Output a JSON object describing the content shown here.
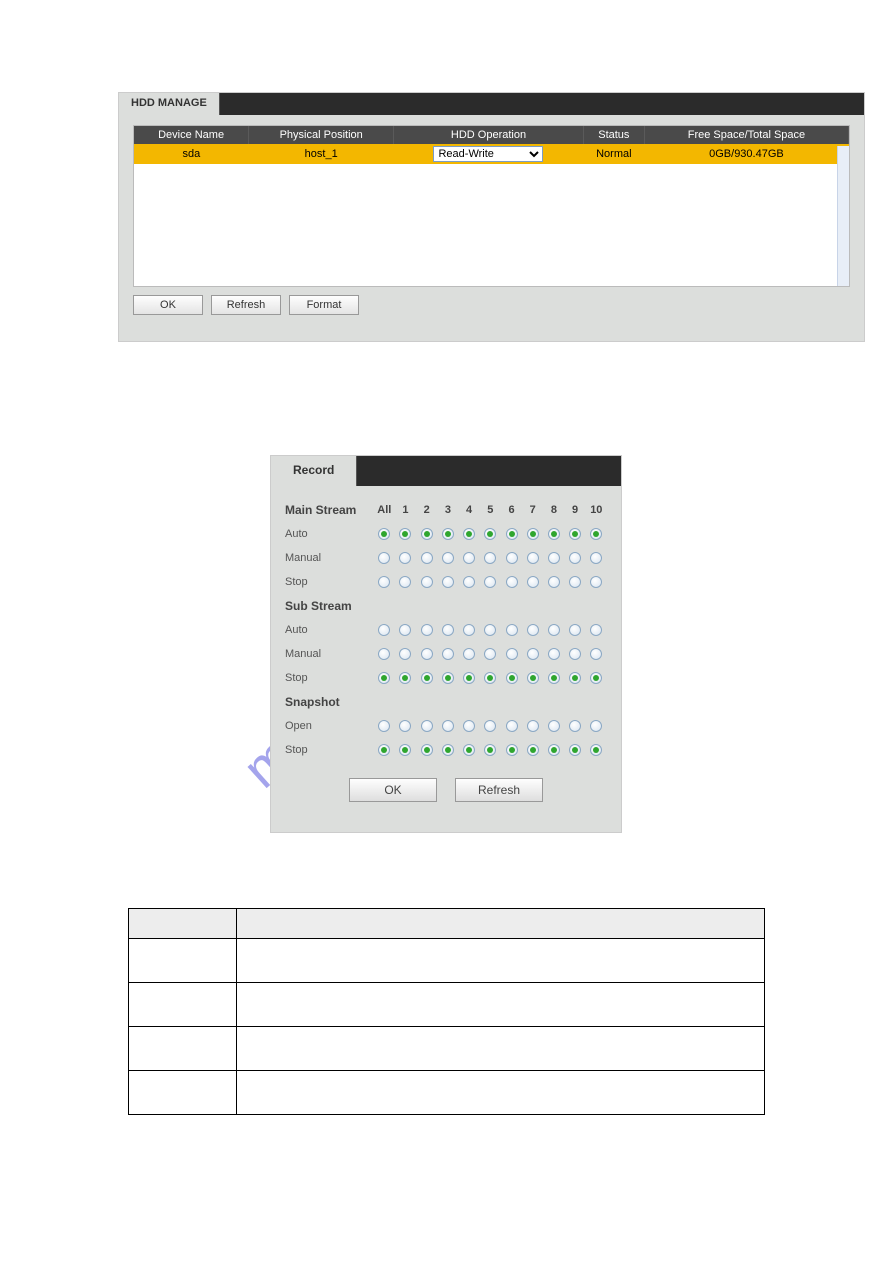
{
  "hdd": {
    "tab": "HDD MANAGE",
    "headers": [
      "Device Name",
      "Physical Position",
      "HDD Operation",
      "Status",
      "Free Space/Total Space"
    ],
    "row": {
      "device": "sda",
      "position": "host_1",
      "operation": "Read-Write",
      "status": "Normal",
      "space": "0GB/930.47GB"
    },
    "buttons": {
      "ok": "OK",
      "refresh": "Refresh",
      "format": "Format"
    }
  },
  "record": {
    "tab": "Record",
    "columns": [
      "All",
      "1",
      "2",
      "3",
      "4",
      "5",
      "6",
      "7",
      "8",
      "9",
      "10"
    ],
    "sections": [
      {
        "title": "Main Stream",
        "rows": [
          {
            "label": "Auto",
            "sel": [
              1,
              1,
              1,
              1,
              1,
              1,
              1,
              1,
              1,
              1,
              1
            ]
          },
          {
            "label": "Manual",
            "sel": [
              0,
              0,
              0,
              0,
              0,
              0,
              0,
              0,
              0,
              0,
              0
            ]
          },
          {
            "label": "Stop",
            "sel": [
              0,
              0,
              0,
              0,
              0,
              0,
              0,
              0,
              0,
              0,
              0
            ]
          }
        ]
      },
      {
        "title": "Sub Stream",
        "rows": [
          {
            "label": "Auto",
            "sel": [
              0,
              0,
              0,
              0,
              0,
              0,
              0,
              0,
              0,
              0,
              0
            ]
          },
          {
            "label": "Manual",
            "sel": [
              0,
              0,
              0,
              0,
              0,
              0,
              0,
              0,
              0,
              0,
              0
            ]
          },
          {
            "label": "Stop",
            "sel": [
              1,
              1,
              1,
              1,
              1,
              1,
              1,
              1,
              1,
              1,
              1
            ]
          }
        ]
      },
      {
        "title": "Snapshot",
        "rows": [
          {
            "label": "Open",
            "sel": [
              0,
              0,
              0,
              0,
              0,
              0,
              0,
              0,
              0,
              0,
              0
            ]
          },
          {
            "label": "Stop",
            "sel": [
              1,
              1,
              1,
              1,
              1,
              1,
              1,
              1,
              1,
              1,
              1
            ]
          }
        ]
      }
    ],
    "buttons": {
      "ok": "OK",
      "refresh": "Refresh"
    }
  },
  "watermark": "manualshive.com"
}
